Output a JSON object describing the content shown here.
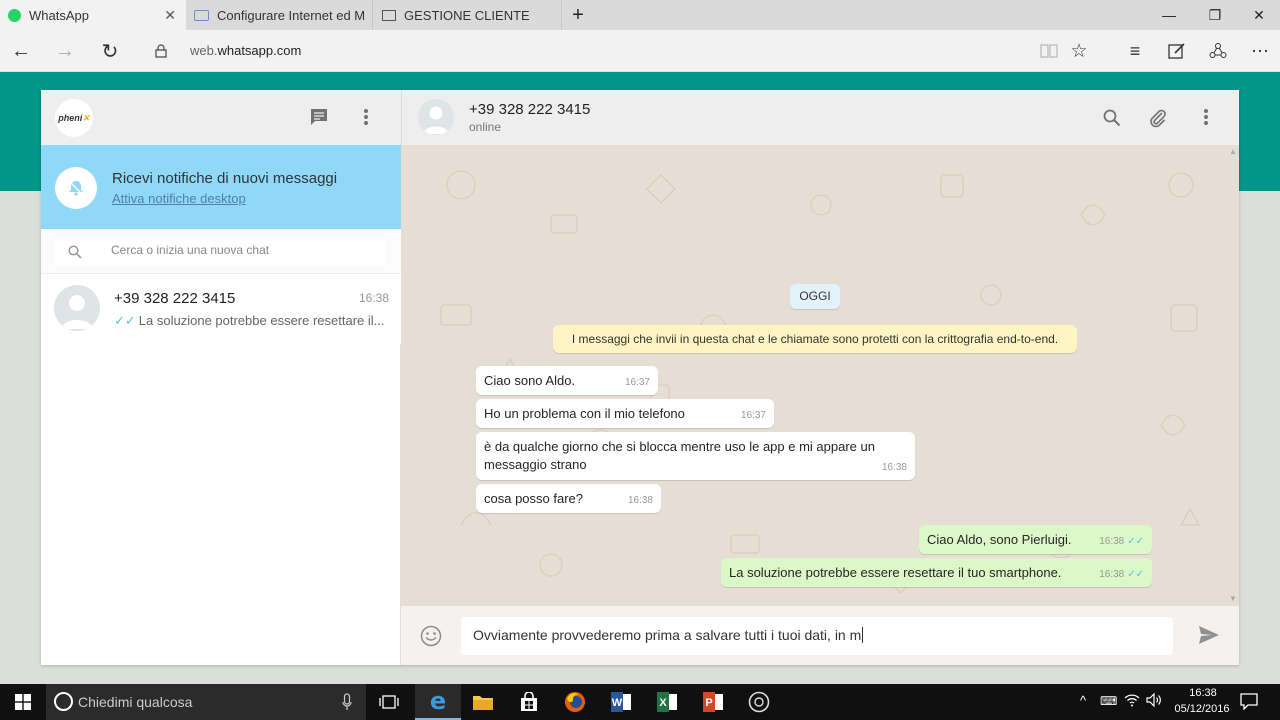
{
  "browser": {
    "tabs": [
      {
        "title": "WhatsApp",
        "active": true
      },
      {
        "title": "Configurare Internet ed MM",
        "active": false
      },
      {
        "title": "GESTIONE CLIENTE",
        "active": false
      }
    ],
    "url_domain_prefix": "web.",
    "url_domain": "whatsapp.com"
  },
  "sidebar": {
    "logo_text": "pheni",
    "notification": {
      "title": "Ricevi notifiche di nuovi messaggi",
      "link": "Attiva notifiche desktop"
    },
    "search_placeholder": "Cerca o inizia una nuova chat",
    "chats": [
      {
        "name": "+39 328 222 3415",
        "time": "16:38",
        "preview": "La soluzione potrebbe essere resettare il..."
      }
    ]
  },
  "conversation": {
    "contact_name": "+39 328 222 3415",
    "contact_status": "online",
    "date_divider": "OGGI",
    "encryption_notice": "I messaggi che invii in questa chat e le chiamate sono protetti con la crittografia end-to-end.",
    "messages": [
      {
        "direction": "in",
        "text": "Ciao sono Aldo.",
        "time": "16:37"
      },
      {
        "direction": "in",
        "text": "Ho un problema con il mio telefono",
        "time": "16:37"
      },
      {
        "direction": "in",
        "text": "è da qualche giorno che si blocca mentre uso le app e mi appare un messaggio strano",
        "time": "16:38"
      },
      {
        "direction": "in",
        "text": "cosa posso fare?",
        "time": "16:38"
      },
      {
        "direction": "out",
        "text": "Ciao Aldo, sono Pierluigi.",
        "time": "16:38"
      },
      {
        "direction": "out",
        "text": "La soluzione potrebbe essere resettare il tuo smartphone.",
        "time": "16:38"
      }
    ],
    "draft": "Ovviamente provvederemo prima a salvare tutti i tuoi dati, in m"
  },
  "taskbar": {
    "search_text": "Chiedimi qualcosa",
    "time": "16:38",
    "date": "05/12/2016"
  },
  "colors": {
    "teal": "#009688",
    "notif_bg": "#8fd8f8",
    "out_bubble": "#dcf8c6",
    "chat_bg": "#e6ddd4"
  }
}
